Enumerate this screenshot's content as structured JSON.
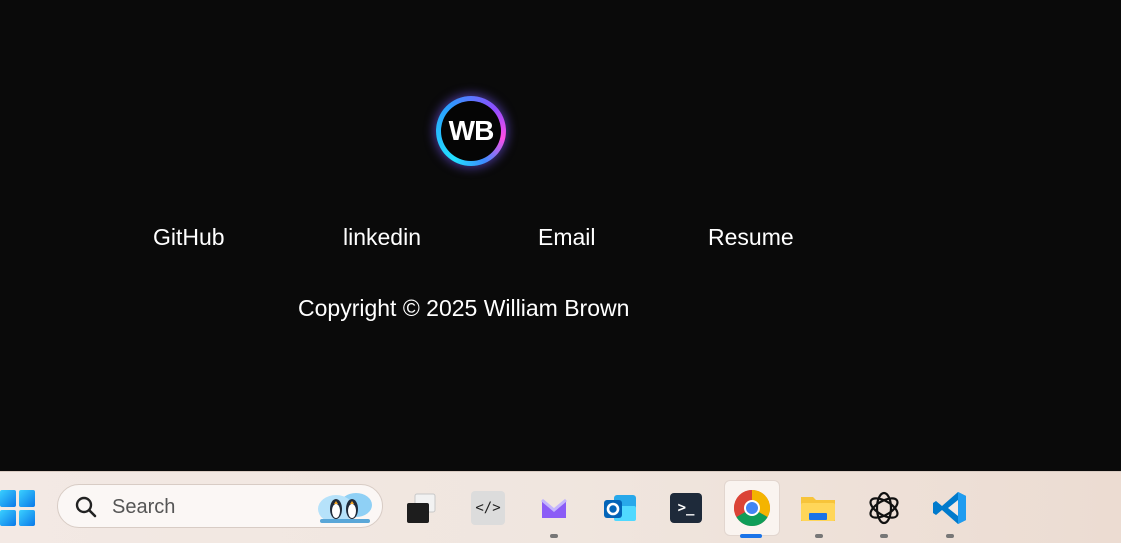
{
  "logo": {
    "text": "WB"
  },
  "links": [
    {
      "label": "GitHub"
    },
    {
      "label": "linkedin"
    },
    {
      "label": "Email"
    },
    {
      "label": "Resume"
    }
  ],
  "copyright": "Copyright © 2025 William Brown",
  "taskbar": {
    "search_placeholder": "Search",
    "apps": [
      {
        "name": "task-view-icon"
      },
      {
        "name": "dev-home-icon"
      },
      {
        "name": "proton-mail-icon"
      },
      {
        "name": "outlook-icon"
      },
      {
        "name": "terminal-icon"
      },
      {
        "name": "chrome-icon",
        "active": true
      },
      {
        "name": "file-explorer-icon"
      },
      {
        "name": "chatgpt-icon"
      },
      {
        "name": "vscode-icon"
      }
    ],
    "dev_home_glyph": "</>",
    "terminal_glyph": ">_"
  }
}
